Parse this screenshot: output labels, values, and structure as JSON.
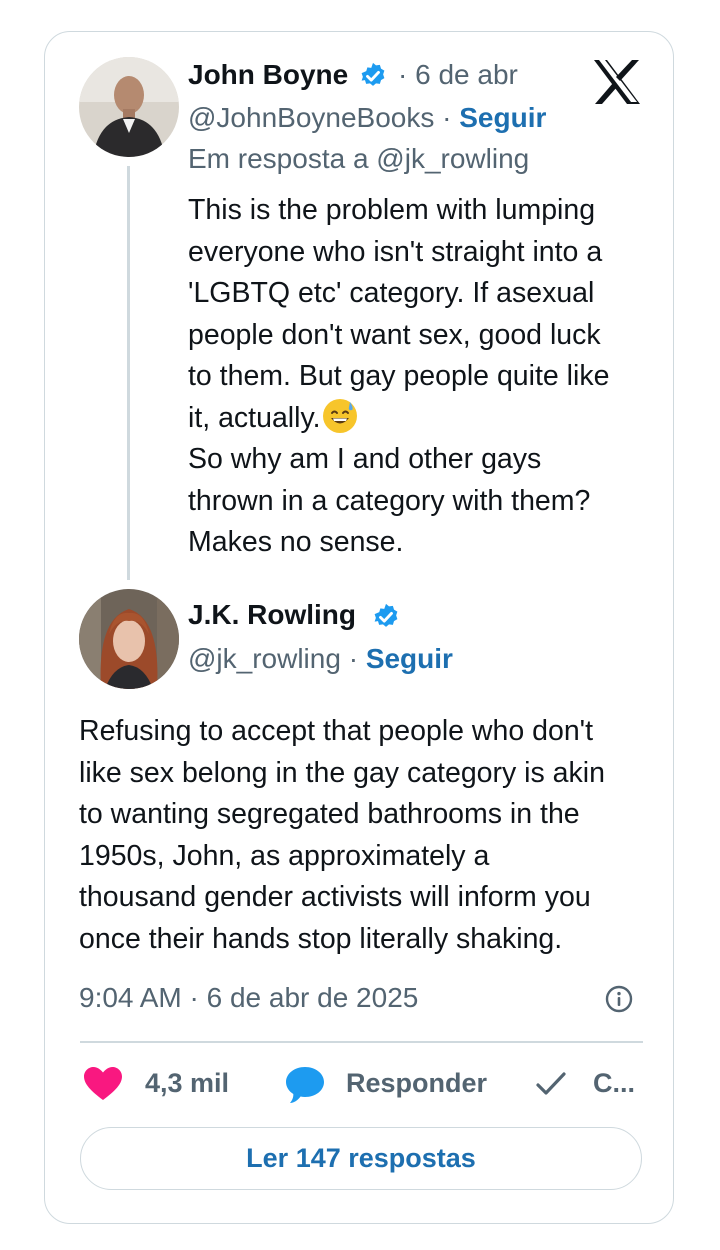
{
  "reply_tweet": {
    "author_name": "John Boyne",
    "date": "· 6 de abr",
    "handle": "@JohnBoyneBooks",
    "separator": "·",
    "follow_label": "Seguir",
    "reply_to": "Em resposta a @jk_rowling",
    "text_lines": [
      "This is the problem with lumping",
      "everyone who isn't straight into a",
      "'LGBTQ etc' category. If asexual",
      "people don't want sex, good luck",
      "to them. But gay people quite like",
      "it, actually.",
      "So why am I and other gays",
      "thrown in a category with them?",
      "Makes no sense."
    ],
    "emoji_icon": "grinning-face-with-sweat-emoji"
  },
  "main_tweet": {
    "author_name": "J.K. Rowling",
    "handle": "@jk_rowling",
    "separator": "·",
    "follow_label": "Seguir",
    "text_lines": [
      "Refusing to accept that people who don't",
      "like sex belong in the gay category is akin",
      "to wanting segregated bathrooms in the",
      "1950s, John, as approximately a",
      "thousand gender activists will inform you",
      "once their hands stop literally shaking."
    ],
    "timestamp": "9:04 AM · 6 de abr de 2025"
  },
  "actions": {
    "likes": "4,3 mil",
    "reply_label": "Responder",
    "copy_label": "C..."
  },
  "read_replies_label": "Ler 147 respostas",
  "icons": {
    "verified": "verified-badge-icon",
    "logo": "x-logo-icon",
    "info": "info-icon",
    "like": "heart-icon",
    "reply": "speech-bubble-icon",
    "copy": "checkmark-icon"
  },
  "colors": {
    "accent": "#1d6fb0",
    "verified": "#1d9bf0",
    "like": "#f91880",
    "secondary_text": "#536471",
    "border": "#cfd9de"
  }
}
